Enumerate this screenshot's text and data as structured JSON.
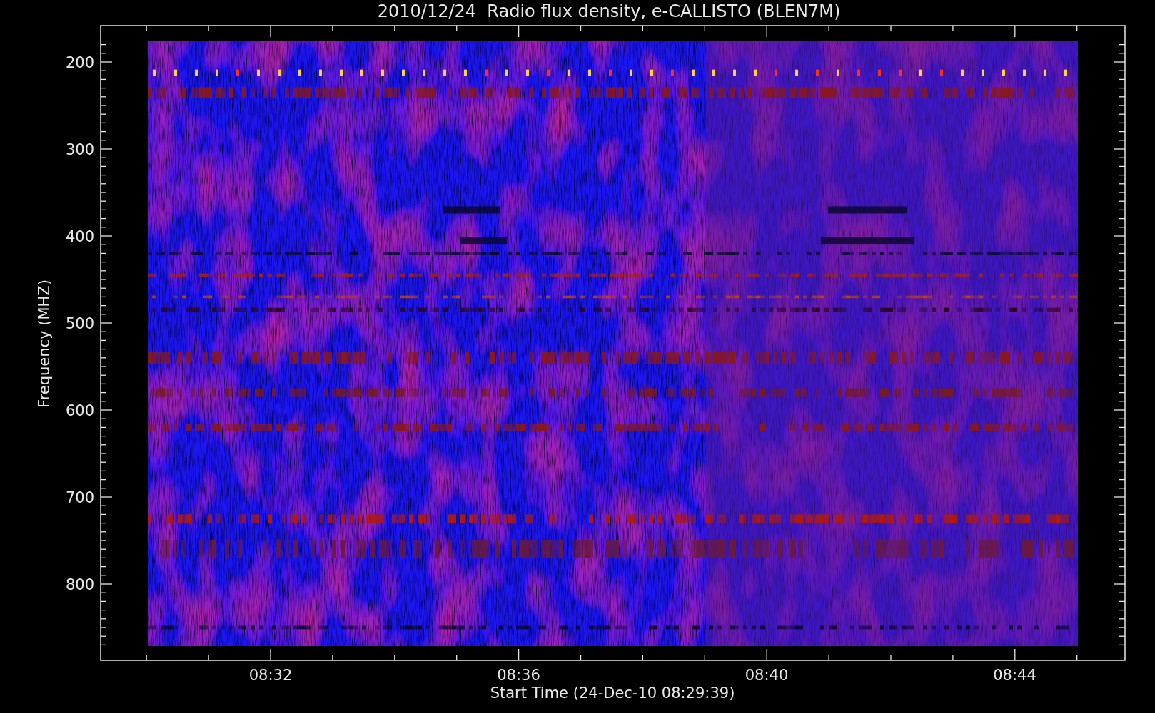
{
  "title": "2010/12/24  Radio flux density, e-CALLISTO (BLEN7M)",
  "y_axis": {
    "label": "Frequency (MHZ)",
    "ticks": [
      "200",
      "300",
      "400",
      "500",
      "600",
      "700",
      "800"
    ]
  },
  "x_axis": {
    "label": "Start Time (24-Dec-10 08:29:39)",
    "ticks": [
      "08:32",
      "08:36",
      "08:40",
      "08:44"
    ]
  }
}
